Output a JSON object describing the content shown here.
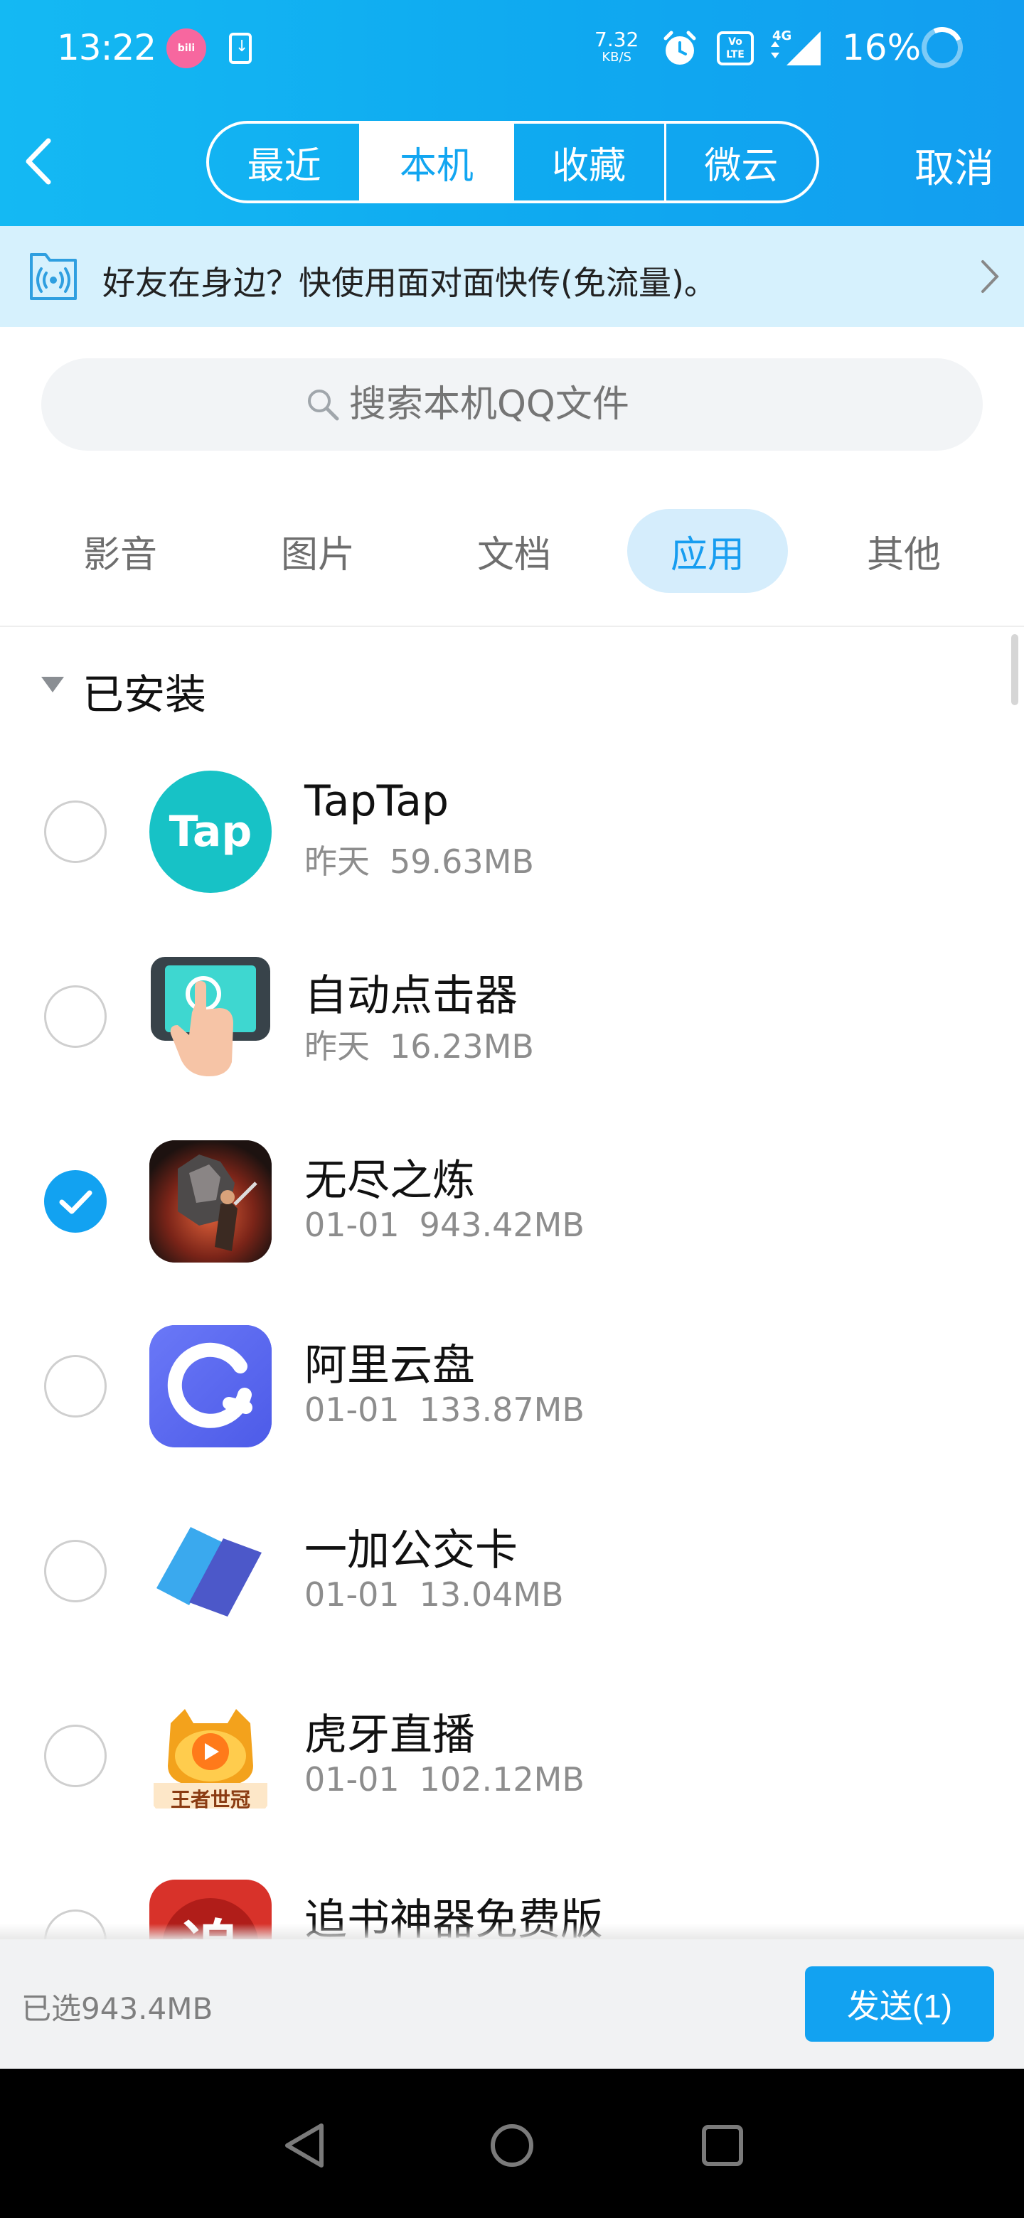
{
  "status_bar": {
    "time": "13:22",
    "network_speed_value": "7.32",
    "network_speed_unit": "KB/S",
    "network_type": "4G",
    "volte_label": "Vo LTE",
    "battery": "16%"
  },
  "header": {
    "tabs": [
      {
        "label": "最近",
        "active": false
      },
      {
        "label": "本机",
        "active": true
      },
      {
        "label": "收藏",
        "active": false
      },
      {
        "label": "微云",
        "active": false
      }
    ],
    "cancel_label": "取消"
  },
  "banner": {
    "text": "好友在身边？快使用面对面快传(免流量)。"
  },
  "search": {
    "placeholder": "搜索本机QQ文件"
  },
  "categories": [
    {
      "label": "影音",
      "active": false
    },
    {
      "label": "图片",
      "active": false
    },
    {
      "label": "文档",
      "active": false
    },
    {
      "label": "应用",
      "active": true
    },
    {
      "label": "其他",
      "active": false
    }
  ],
  "group": {
    "label": "已安装"
  },
  "apps": [
    {
      "name": "TapTap",
      "date": "昨天",
      "size": "59.63MB",
      "checked": false,
      "icon": "taptap-icon",
      "icon_text": "Tap"
    },
    {
      "name": "自动点击器",
      "date": "昨天",
      "size": "16.23MB",
      "checked": false,
      "icon": "auto-clicker-icon"
    },
    {
      "name": "无尽之炼",
      "date": "01-01",
      "size": "943.42MB",
      "checked": true,
      "icon": "endless-game-icon"
    },
    {
      "name": "阿里云盘",
      "date": "01-01",
      "size": "133.87MB",
      "checked": false,
      "icon": "aliyun-drive-icon"
    },
    {
      "name": "一加公交卡",
      "date": "01-01",
      "size": "13.04MB",
      "checked": false,
      "icon": "bus-card-icon"
    },
    {
      "name": "虎牙直播",
      "date": "01-01",
      "size": "102.12MB",
      "checked": false,
      "icon": "huya-icon",
      "icon_text": "王者世冠"
    },
    {
      "name": "追书神器免费版",
      "date": "",
      "size": "",
      "checked": false,
      "icon": "zhuishu-icon",
      "icon_text": "追"
    }
  ],
  "footer": {
    "selected_text": "已选943.4MB",
    "send_label": "发送(1)"
  },
  "colors": {
    "accent": "#12a2f1",
    "banner_bg": "#d6f1fd",
    "active_category_bg": "#d5edfc"
  }
}
